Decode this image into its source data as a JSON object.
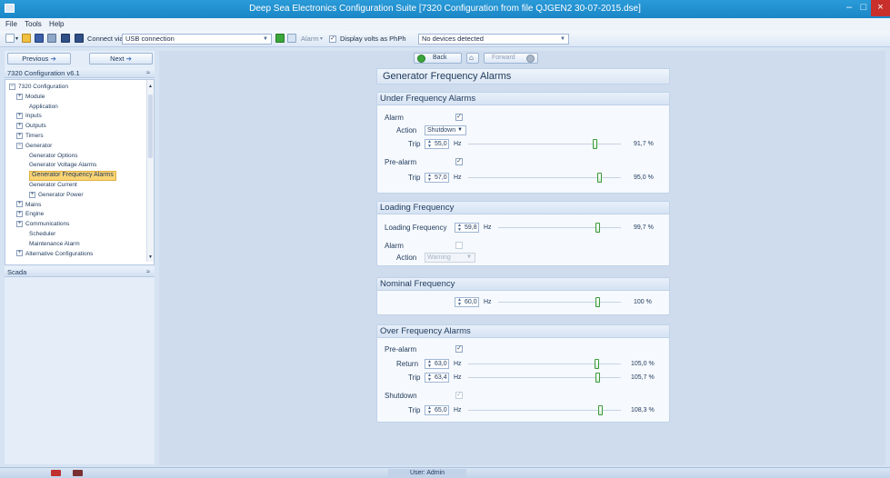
{
  "window": {
    "title": "Deep Sea Electronics Configuration Suite [7320 Configuration from file QJGEN2 30-07-2015.dse]",
    "minimize": "–",
    "maximize": "□",
    "close": "×"
  },
  "menu": [
    "File",
    "Tools",
    "Help"
  ],
  "toolbar": {
    "connect_label": "Connect via",
    "connect_value": "USB connection",
    "alarm_label": "Alarm",
    "display_volts_label": "Display volts as PhPh",
    "device_value": "No devices detected"
  },
  "nav": {
    "previous": "Previous",
    "next": "Next",
    "back": "Back",
    "forward": "Forward"
  },
  "left_panel": {
    "header": "7320 Configuration v6.1",
    "scada_header": "Scada",
    "tree": [
      {
        "label": "7320 Configuration",
        "indent": 0,
        "expander": "−",
        "selected": false
      },
      {
        "label": "Module",
        "indent": 1,
        "expander": "+",
        "selected": false
      },
      {
        "label": "Application",
        "indent": 2,
        "expander": "",
        "selected": false
      },
      {
        "label": "Inputs",
        "indent": 1,
        "expander": "+",
        "selected": false
      },
      {
        "label": "Outputs",
        "indent": 1,
        "expander": "+",
        "selected": false
      },
      {
        "label": "Timers",
        "indent": 1,
        "expander": "+",
        "selected": false
      },
      {
        "label": "Generator",
        "indent": 1,
        "expander": "−",
        "selected": false
      },
      {
        "label": "Generator Options",
        "indent": 2,
        "expander": "",
        "selected": false
      },
      {
        "label": "Generator Voltage Alarms",
        "indent": 2,
        "expander": "",
        "selected": false
      },
      {
        "label": "Generator Frequency Alarms",
        "indent": 2,
        "expander": "",
        "selected": true
      },
      {
        "label": "Generator Current",
        "indent": 2,
        "expander": "",
        "selected": false
      },
      {
        "label": "Generator Power",
        "indent": 2,
        "expander": "+",
        "selected": false
      },
      {
        "label": "Mains",
        "indent": 1,
        "expander": "+",
        "selected": false
      },
      {
        "label": "Engine",
        "indent": 1,
        "expander": "+",
        "selected": false
      },
      {
        "label": "Communications",
        "indent": 1,
        "expander": "+",
        "selected": false
      },
      {
        "label": "Scheduler",
        "indent": 2,
        "expander": "",
        "selected": false
      },
      {
        "label": "Maintenance Alarm",
        "indent": 2,
        "expander": "",
        "selected": false
      },
      {
        "label": "Alternative Configurations",
        "indent": 1,
        "expander": "+",
        "selected": false
      }
    ]
  },
  "page_title": "Generator Frequency Alarms",
  "under_frequency": {
    "title": "Under Frequency Alarms",
    "alarm_label": "Alarm",
    "alarm_checked": true,
    "action_label": "Action",
    "action_value": "Shutdown",
    "trip_label": "Trip",
    "trip_value": "55,0",
    "trip_unit": "Hz",
    "trip_pct": "91,7 %",
    "trip_fraction": 0.917,
    "prealarm_label": "Pre-alarm",
    "prealarm_checked": true,
    "pre_trip_label": "Trip",
    "pre_trip_value": "57,0",
    "pre_trip_unit": "Hz",
    "pre_trip_pct": "95,0 %",
    "pre_trip_fraction": 0.95
  },
  "loading_frequency": {
    "title": "Loading Frequency",
    "label": "Loading Frequency",
    "value": "59,8",
    "unit": "Hz",
    "pct": "99,7 %",
    "fraction": 0.997,
    "alarm_label": "Alarm",
    "alarm_checked": false,
    "action_label": "Action",
    "action_value": "Warning"
  },
  "nominal_frequency": {
    "title": "Nominal Frequency",
    "value": "60,0",
    "unit": "Hz",
    "pct": "100 %",
    "fraction": 1.0
  },
  "over_frequency": {
    "title": "Over Frequency Alarms",
    "prealarm_label": "Pre-alarm",
    "prealarm_checked": true,
    "return_label": "Return",
    "return_value": "63,0",
    "return_unit": "Hz",
    "return_pct": "105,0 %",
    "return_fraction": 1.05,
    "trip_label": "Trip",
    "trip_value": "63,4",
    "trip_unit": "Hz",
    "trip_pct": "105,7 %",
    "trip_fraction": 1.057,
    "shutdown_label": "Shutdown",
    "shutdown_checked": true,
    "shutdown_trip_label": "Trip",
    "shutdown_trip_value": "65,0",
    "shutdown_trip_unit": "Hz",
    "shutdown_trip_pct": "108,3 %",
    "shutdown_trip_fraction": 1.083
  },
  "status": {
    "user": "User: Admin"
  },
  "colors": {
    "title_bar": "#1a86c7",
    "close_button": "#c9302c",
    "selection": "#fbd574",
    "slider_thumb": "#3a9a3a"
  }
}
